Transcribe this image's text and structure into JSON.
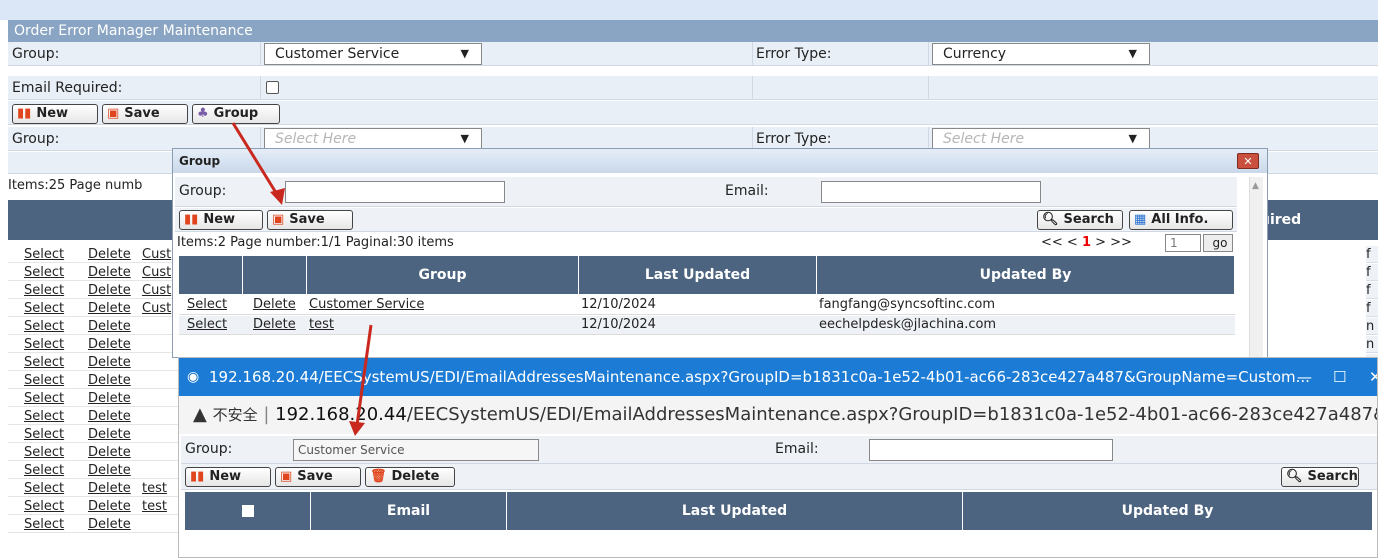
{
  "main": {
    "title": "Order Error Manager Maintenance",
    "group_label": "Group:",
    "group_value": "Customer Service",
    "error_type_label": "Error Type:",
    "error_type_value": "Currency",
    "email_required_label": "Email Required:",
    "buttons": {
      "new": "New",
      "save": "Save",
      "group": "Group"
    },
    "filter_group_label": "Group:",
    "filter_group_placeholder": "Select Here",
    "filter_error_type_label": "Error Type:",
    "filter_error_type_placeholder": "Select Here",
    "items_text": "Items:25   Page numb",
    "header_right": "uired",
    "row_select": "Select",
    "row_delete": "Delete",
    "row_groups": [
      "Cust",
      "Cust",
      "Cust",
      "Cust",
      "",
      "",
      "",
      "",
      "",
      "",
      "",
      "",
      "",
      "test",
      "test",
      ""
    ],
    "right_col": [
      "f",
      "f",
      "f",
      "f",
      "n",
      "n",
      "",
      "",
      "",
      "",
      "",
      "",
      "",
      "",
      "",
      ""
    ]
  },
  "group_dialog": {
    "title": "Group",
    "group_label": "Group:",
    "email_label": "Email:",
    "buttons": {
      "new": "New",
      "save": "Save",
      "search": "Search",
      "all_info": "All Info."
    },
    "items_info": "Items:2   Page number:1/1   Paginal:30 items",
    "pager": {
      "prev": "<< <",
      "current": "1",
      "next": "> >>",
      "page_input": "1",
      "go": "go"
    },
    "columns": [
      "Group",
      "Last Updated",
      "Updated By"
    ],
    "rows": [
      {
        "select": "Select",
        "delete": "Delete",
        "group": "Customer Service",
        "last_updated": "12/10/2024",
        "updated_by": "fangfang@syncsoftinc.com"
      },
      {
        "select": "Select",
        "delete": "Delete",
        "group": "test",
        "last_updated": "12/10/2024",
        "updated_by": "eechelpdesk@jlachina.com"
      }
    ]
  },
  "popup": {
    "title_url": "192.168.20.44/EECSystemUS/EDI/EmailAddressesMaintenance.aspx?GroupID=b1831c0a-1e52-4b01-ac66-283ce427a487&GroupName=Custom...",
    "insecure_label": "不安全",
    "address_host": "192.168.20.44",
    "address_path": "/EECSystemUS/EDI/EmailAddressesMaintenance.aspx?GroupID=b1831c0a-1e52-4b01-ac66-283ce427a487&GroupN...",
    "group_label": "Group:",
    "group_value": "Customer Service",
    "email_label": "Email:",
    "buttons": {
      "new": "New",
      "save": "Save",
      "delete": "Delete",
      "search": "Search"
    },
    "columns": [
      "Email",
      "Last Updated",
      "Updated By"
    ]
  },
  "colors": {
    "header_bg": "#4d6480",
    "title_bg": "#8aa4c4",
    "browser_bar": "#1c7bd4",
    "arrow": "#c8281e"
  }
}
